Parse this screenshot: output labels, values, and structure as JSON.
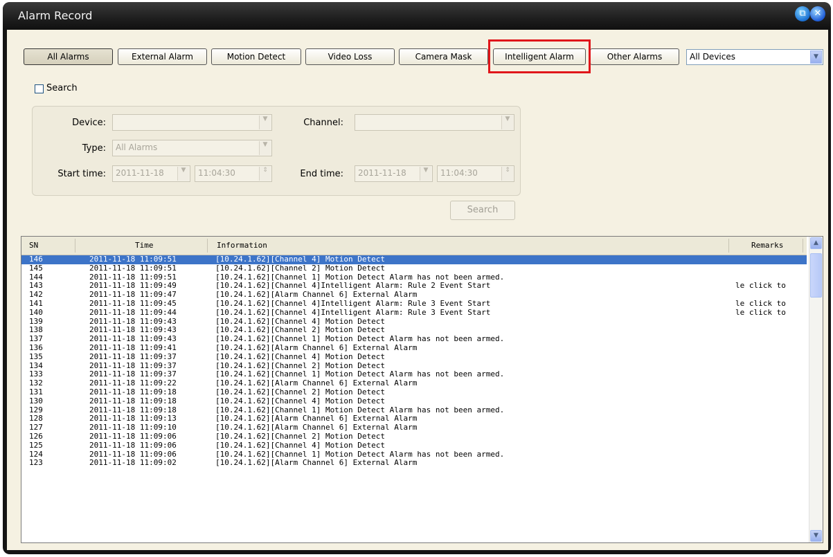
{
  "window": {
    "title": "Alarm Record"
  },
  "filters": [
    {
      "label": "All Alarms",
      "active": true
    },
    {
      "label": "External Alarm",
      "active": false
    },
    {
      "label": "Motion Detect",
      "active": false
    },
    {
      "label": "Video Loss",
      "active": false
    },
    {
      "label": "Camera Mask",
      "active": false
    },
    {
      "label": "Intelligent Alarm",
      "active": false
    },
    {
      "label": "Other Alarms",
      "active": false
    }
  ],
  "device_filter": {
    "value": "All Devices"
  },
  "search_toggle": {
    "label": "Search",
    "checked": false
  },
  "search_form": {
    "device_label": "Device:",
    "device_value": "",
    "channel_label": "Channel:",
    "channel_value": "",
    "type_label": "Type:",
    "type_value": "All Alarms",
    "start_label": "Start time:",
    "start_date": "2011-11-18",
    "start_time": "11:04:30",
    "end_label": "End time:",
    "end_date": "2011-11-18",
    "end_time": "11:04:30",
    "search_button": "Search"
  },
  "table": {
    "columns": [
      "SN",
      "Time",
      "Information",
      "Remarks"
    ],
    "selected_row": 0,
    "rows": [
      [
        "146",
        "2011-11-18 11:09:51",
        "[10.24.1.62][Channel 4] Motion Detect",
        ""
      ],
      [
        "145",
        "2011-11-18 11:09:51",
        "[10.24.1.62][Channel 2] Motion Detect",
        ""
      ],
      [
        "144",
        "2011-11-18 11:09:51",
        "[10.24.1.62][Channel 1] Motion Detect Alarm has not been armed.",
        ""
      ],
      [
        "143",
        "2011-11-18 11:09:49",
        "[10.24.1.62][Channel 4]Intelligent Alarm: Rule 2 Event Start",
        "le click to"
      ],
      [
        "142",
        "2011-11-18 11:09:47",
        "[10.24.1.62][Alarm Channel 6] External Alarm",
        ""
      ],
      [
        "141",
        "2011-11-18 11:09:45",
        "[10.24.1.62][Channel 4]Intelligent Alarm: Rule 3 Event Start",
        "le click to"
      ],
      [
        "140",
        "2011-11-18 11:09:44",
        "[10.24.1.62][Channel 4]Intelligent Alarm: Rule 3 Event Start",
        "le click to"
      ],
      [
        "139",
        "2011-11-18 11:09:43",
        "[10.24.1.62][Channel 4] Motion Detect",
        ""
      ],
      [
        "138",
        "2011-11-18 11:09:43",
        "[10.24.1.62][Channel 2] Motion Detect",
        ""
      ],
      [
        "137",
        "2011-11-18 11:09:43",
        "[10.24.1.62][Channel 1] Motion Detect Alarm has not been armed.",
        ""
      ],
      [
        "136",
        "2011-11-18 11:09:41",
        "[10.24.1.62][Alarm Channel 6] External Alarm",
        ""
      ],
      [
        "135",
        "2011-11-18 11:09:37",
        "[10.24.1.62][Channel 4] Motion Detect",
        ""
      ],
      [
        "134",
        "2011-11-18 11:09:37",
        "[10.24.1.62][Channel 2] Motion Detect",
        ""
      ],
      [
        "133",
        "2011-11-18 11:09:37",
        "[10.24.1.62][Channel 1] Motion Detect Alarm has not been armed.",
        ""
      ],
      [
        "132",
        "2011-11-18 11:09:22",
        "[10.24.1.62][Alarm Channel 6] External Alarm",
        ""
      ],
      [
        "131",
        "2011-11-18 11:09:18",
        "[10.24.1.62][Channel 2] Motion Detect",
        ""
      ],
      [
        "130",
        "2011-11-18 11:09:18",
        "[10.24.1.62][Channel 4] Motion Detect",
        ""
      ],
      [
        "129",
        "2011-11-18 11:09:18",
        "[10.24.1.62][Channel 1] Motion Detect Alarm has not been armed.",
        ""
      ],
      [
        "128",
        "2011-11-18 11:09:13",
        "[10.24.1.62][Alarm Channel 6] External Alarm",
        ""
      ],
      [
        "127",
        "2011-11-18 11:09:10",
        "[10.24.1.62][Alarm Channel 6] External Alarm",
        ""
      ],
      [
        "126",
        "2011-11-18 11:09:06",
        "[10.24.1.62][Channel 2] Motion Detect",
        ""
      ],
      [
        "125",
        "2011-11-18 11:09:06",
        "[10.24.1.62][Channel 4] Motion Detect",
        ""
      ],
      [
        "124",
        "2011-11-18 11:09:06",
        "[10.24.1.62][Channel 1] Motion Detect Alarm has not been armed.",
        ""
      ],
      [
        "123",
        "2011-11-18 11:09:02",
        "[10.24.1.62][Alarm Channel 6] External Alarm",
        ""
      ]
    ]
  },
  "colors": {
    "highlight_box": "#e0161b",
    "selection": "#3d74c8"
  },
  "icons": {
    "restore": "restore-icon",
    "close": "close-icon",
    "dropdown": "chevron-down-icon",
    "spin": "spinner-icon"
  }
}
